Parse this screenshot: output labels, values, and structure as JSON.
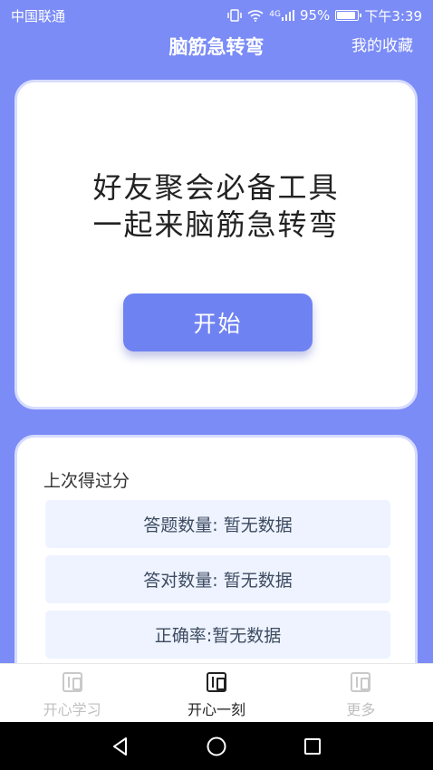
{
  "status_bar": {
    "carrier": "中国联通",
    "battery_percent": "95%",
    "time": "下午3:39",
    "network": "4G",
    "battery_level": 0.95
  },
  "header": {
    "title": "脑筋急转弯",
    "favorites_label": "我的收藏"
  },
  "hero": {
    "line1": "好友聚会必备工具",
    "line2": "一起来脑筋急转弯",
    "start_label": "开始"
  },
  "score": {
    "title": "上次得过分",
    "rows": [
      "答题数量: 暂无数据",
      "答对数量: 暂无数据",
      "正确率:暂无数据"
    ]
  },
  "tabs": [
    {
      "label": "开心学习",
      "icon": "book-icon",
      "active": false
    },
    {
      "label": "开心一刻",
      "icon": "book-icon",
      "active": true
    },
    {
      "label": "更多",
      "icon": "book-icon",
      "active": false
    }
  ],
  "colors": {
    "background": "#7b8cf6",
    "accent": "#6f82f2",
    "row_bg": "#eef3ff"
  }
}
